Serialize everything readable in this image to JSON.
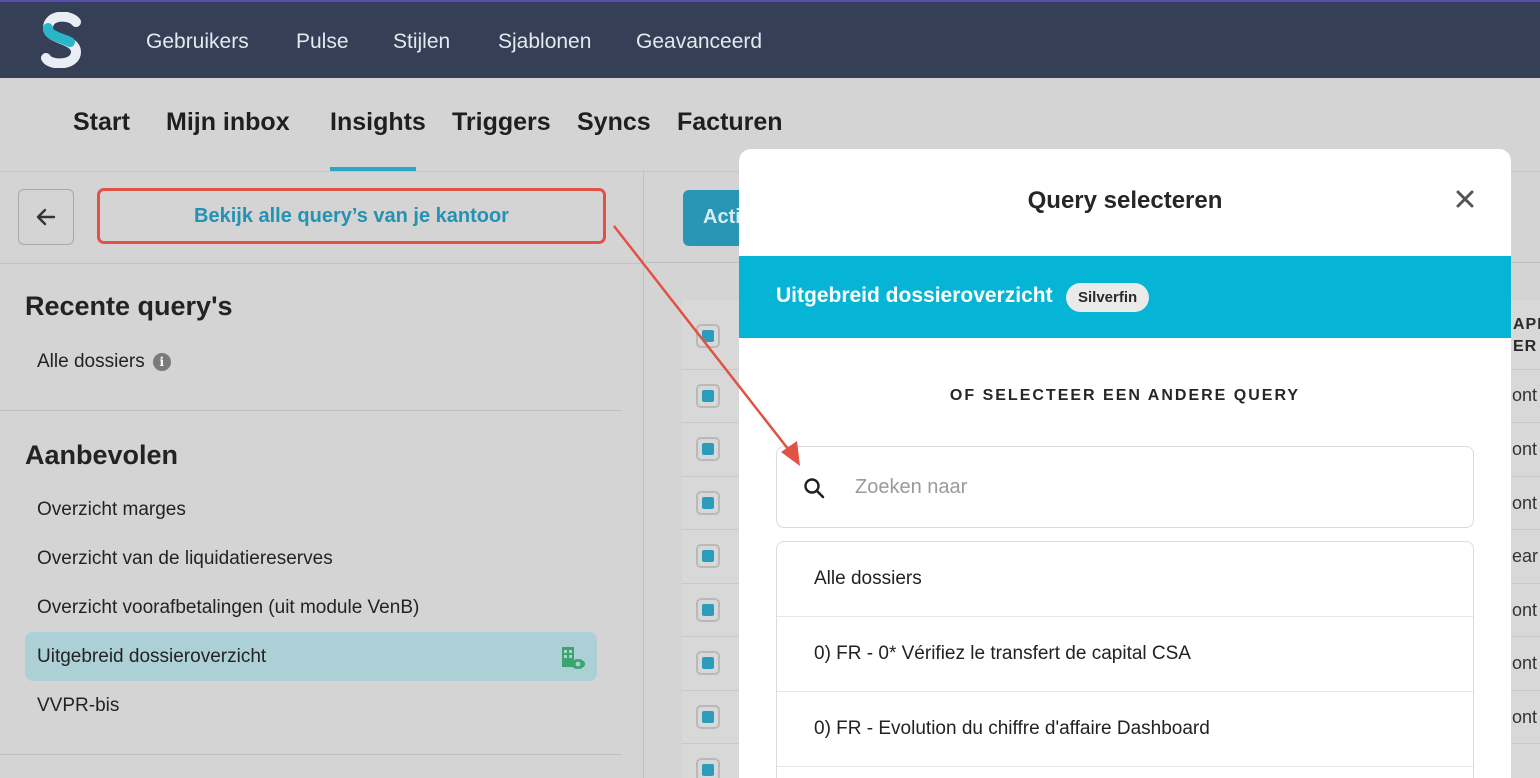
{
  "topnav": {
    "items": [
      "Gebruikers",
      "Pulse",
      "Stijlen",
      "Sjablonen",
      "Geavanceerd"
    ]
  },
  "subnav": {
    "items": [
      "Start",
      "Mijn inbox",
      "Insights",
      "Triggers",
      "Syncs",
      "Facturen"
    ],
    "active": "Insights"
  },
  "leftpanel": {
    "all_queries_button": "Bekijk alle query’s van je kantoor",
    "recent_heading": "Recente query's",
    "recent_items": [
      "Alle dossiers"
    ],
    "recommended_heading": "Aanbevolen",
    "recommended_items": [
      "Overzicht marges",
      "Overzicht van de liquidatiereserves",
      "Overzicht voorafbetalingen (uit module VenB)",
      "Uitgebreid dossieroverzicht",
      "VVPR-bis"
    ],
    "selected_item": "Uitgebreid dossieroverzicht"
  },
  "background": {
    "action_button_partial": "Acti",
    "column_header_partial": "APP ER",
    "row_edge_texts": [
      "ont",
      "ont",
      "ont",
      "ear",
      "ont",
      "ont",
      "ont"
    ]
  },
  "modal": {
    "title": "Query selecteren",
    "current_query": "Uitgebreid dossieroverzicht",
    "current_query_badge": "Silverfin",
    "or_select_label": "OF SELECTEER EEN ANDERE QUERY",
    "search_placeholder": "Zoeken naar",
    "search_value": "",
    "query_list": [
      "Alle dossiers",
      "0) FR - 0* Vérifiez le transfert de capital CSA",
      "0) FR - Evolution du chiffre d'affaire Dashboard"
    ]
  },
  "colors": {
    "topbar": "#354057",
    "accent": "#06b5d5",
    "annotation": "#e05243"
  }
}
